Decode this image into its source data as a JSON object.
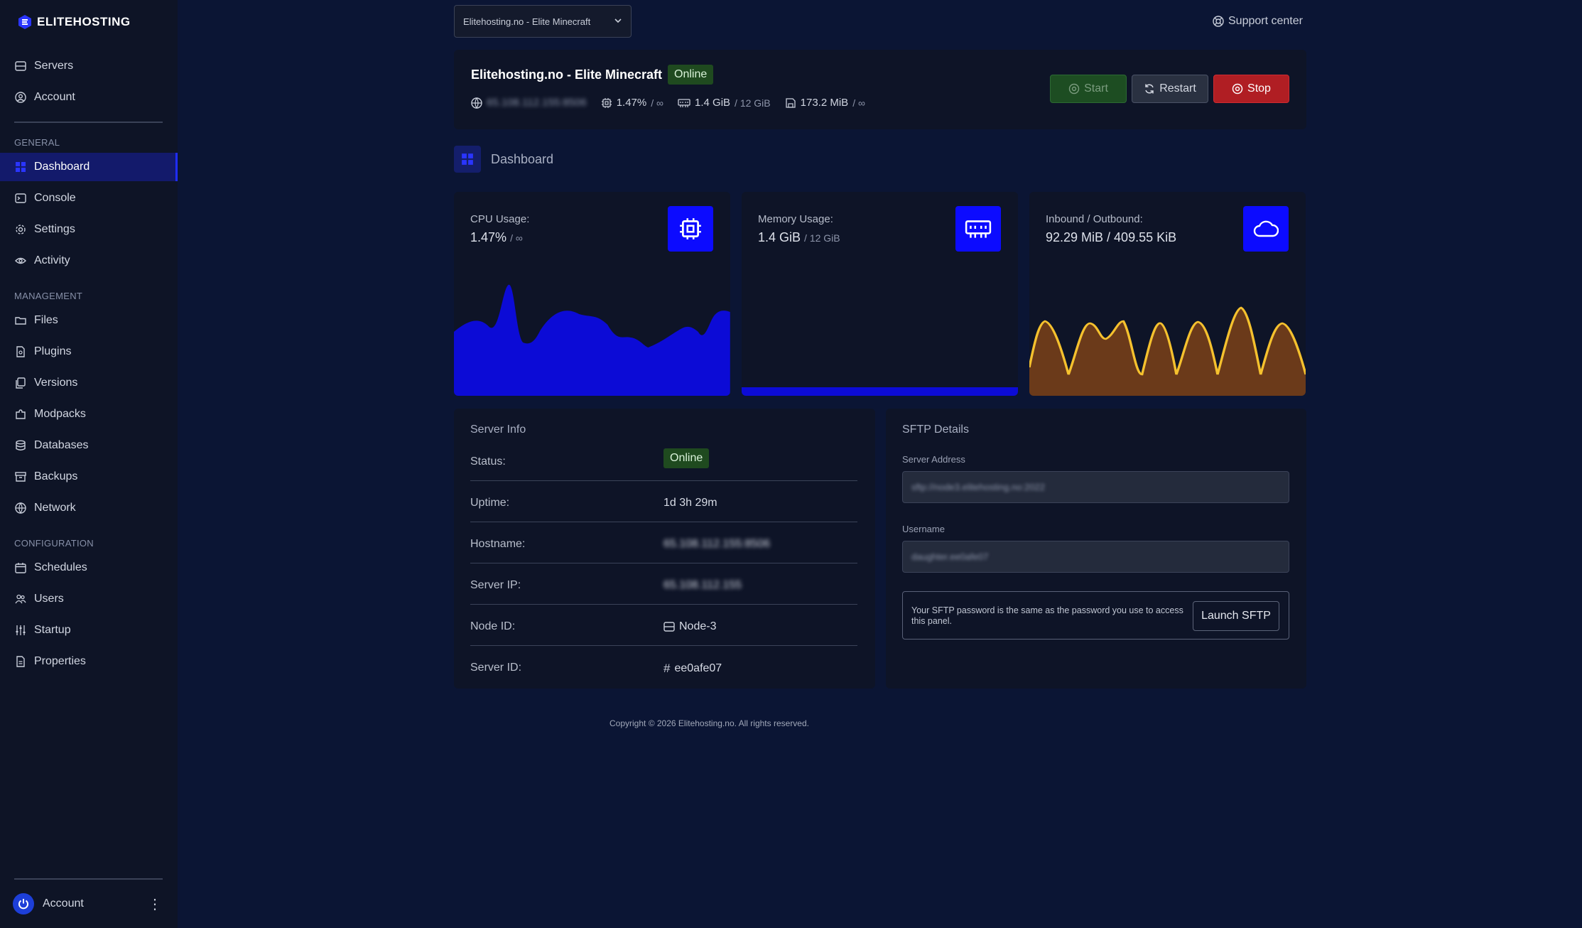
{
  "brand": {
    "name": "ELITEHOSTING"
  },
  "sidebar": {
    "top_items": [
      {
        "label": "Servers",
        "icon": "server-icon"
      },
      {
        "label": "Account",
        "icon": "user-circle-icon"
      }
    ],
    "sections": [
      {
        "label": "GENERAL",
        "items": [
          {
            "label": "Dashboard",
            "icon": "dashboard-icon",
            "active": true
          },
          {
            "label": "Console",
            "icon": "terminal-icon"
          },
          {
            "label": "Settings",
            "icon": "gear-icon"
          },
          {
            "label": "Activity",
            "icon": "eye-icon"
          }
        ]
      },
      {
        "label": "MANAGEMENT",
        "items": [
          {
            "label": "Files",
            "icon": "folder-icon"
          },
          {
            "label": "Plugins",
            "icon": "plugin-file-icon"
          },
          {
            "label": "Versions",
            "icon": "copy-icon"
          },
          {
            "label": "Modpacks",
            "icon": "puzzle-icon"
          },
          {
            "label": "Databases",
            "icon": "database-icon"
          },
          {
            "label": "Backups",
            "icon": "archive-icon"
          },
          {
            "label": "Network",
            "icon": "globe-icon"
          }
        ]
      },
      {
        "label": "CONFIGURATION",
        "items": [
          {
            "label": "Schedules",
            "icon": "calendar-icon"
          },
          {
            "label": "Users",
            "icon": "users-icon"
          },
          {
            "label": "Startup",
            "icon": "sliders-icon"
          },
          {
            "label": "Properties",
            "icon": "document-icon"
          }
        ]
      }
    ],
    "account_label": "Account"
  },
  "topbar": {
    "server_select": "Elitehosting.no - Elite Minecraft",
    "support_label": "Support center"
  },
  "server": {
    "name": "Elitehosting.no - Elite Minecraft",
    "status": "Online",
    "address_blurred": "65.108.112.155:8506",
    "cpu": "1.47%",
    "cpu_limit": "/ ∞",
    "memory": "1.4 GiB",
    "memory_limit": "/ 12 GiB",
    "disk": "173.2 MiB",
    "disk_limit": "/ ∞",
    "buttons": {
      "start": "Start",
      "restart": "Restart",
      "stop": "Stop"
    }
  },
  "dashboard": {
    "title": "Dashboard"
  },
  "metrics": {
    "cpu": {
      "label": "CPU Usage:",
      "value": "1.47%",
      "limit": "/ ∞"
    },
    "memory": {
      "label": "Memory Usage:",
      "value": "1.4 GiB",
      "limit": "/ 12 GiB"
    },
    "network": {
      "label": "Inbound / Outbound:",
      "value": "92.29 MiB / 409.55 KiB"
    }
  },
  "server_info": {
    "title": "Server Info",
    "rows": [
      {
        "key": "Status:",
        "value": "Online"
      },
      {
        "key": "Uptime:",
        "value": "1d 3h 29m"
      },
      {
        "key": "Hostname:",
        "value": "65.108.112.155:8506"
      },
      {
        "key": "Server IP:",
        "value": "65.108.112.155"
      },
      {
        "key": "Node ID:",
        "value": "Node-3"
      },
      {
        "key": "Server ID:",
        "value": "ee0afe07"
      }
    ]
  },
  "sftp": {
    "title": "SFTP Details",
    "address_label": "Server Address",
    "address_value": "sftp://node3.elitehosting.no:2022",
    "username_label": "Username",
    "username_value": "daughter.ee0afe07",
    "note": "Your SFTP password is the same as the password you use to access this panel.",
    "launch_label": "Launch SFTP"
  },
  "footer": {
    "text": "Copyright © 2026 Elitehosting.no. All rights reserved."
  },
  "colors": {
    "accent": "#0c0bff",
    "online": "#1f4a1f",
    "stop": "#b01e23",
    "network_line": "#f5c12e",
    "network_fill": "#6b3a1a"
  }
}
